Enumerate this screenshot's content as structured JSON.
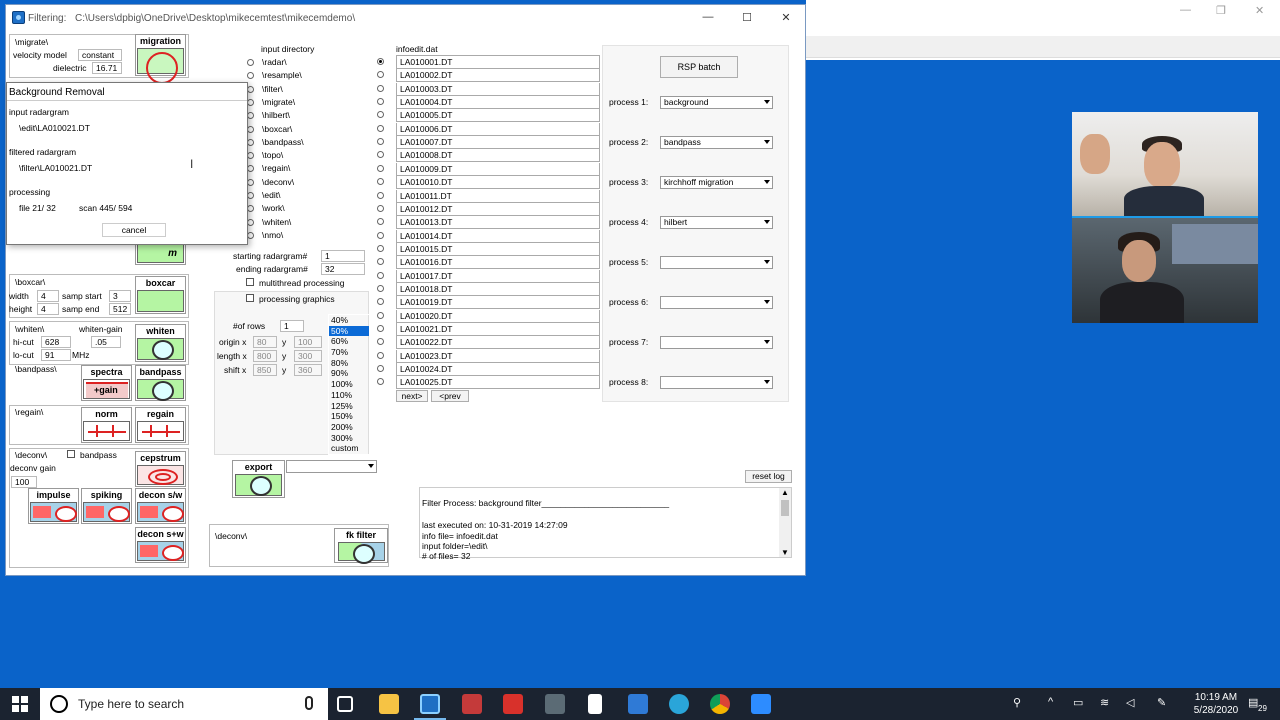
{
  "window": {
    "title": "Filtering:",
    "path": "C:\\Users\\dpbig\\OneDrive\\Desktop\\mikecemtest\\mikecemdemo\\",
    "minimize": "—",
    "maximize": "☐",
    "close": "✕"
  },
  "bg_window": {
    "minimize": "—",
    "restore": "❐",
    "close": "✕"
  },
  "migrate": {
    "dir": "\\migrate\\",
    "velocity_label": "velocity model",
    "velocity_value": "constant",
    "dielectric_label": "dielectric",
    "dielectric_value": "16.71",
    "button": "migration"
  },
  "dialog": {
    "title": "Background Removal",
    "input_label": "input radargram",
    "input_value": "\\edit\\LA010021.DT",
    "filtered_label": "filtered radargram",
    "filtered_value": "\\filter\\LA010021.DT",
    "processing_label": "processing",
    "file_text": "file  21/ 32",
    "scan_text": "scan  445/ 594",
    "cancel": "cancel"
  },
  "mtool": "m",
  "boxcar": {
    "dir": "\\boxcar\\",
    "width_label": "width",
    "width_value": "4",
    "height_label": "height",
    "height_value": "4",
    "samp_start_label": "samp start",
    "samp_start_value": "3",
    "samp_end_label": "samp end",
    "samp_end_value": "512",
    "button": "boxcar"
  },
  "whiten": {
    "dir": "\\whiten\\",
    "gain_label": "whiten-gain",
    "hicut_label": "hi-cut",
    "hicut_value": "628",
    "gain_value": ".05",
    "locut_label": "lo-cut",
    "locut_value": "91",
    "unit": "MHz",
    "button": "whiten"
  },
  "bandpass": {
    "dir": "\\bandpass\\",
    "spectra": "spectra",
    "spectra_gain": "+gain",
    "button": "bandpass"
  },
  "regain": {
    "dir": "\\regain\\",
    "norm": "norm",
    "button": "regain"
  },
  "decon": {
    "dir": "\\deconv\\",
    "bandpass_label": "bandpass",
    "gain_label": "deconv gain",
    "gain_value": "100",
    "cepstrum": "cepstrum",
    "impulse": "impulse",
    "spiking": "spiking",
    "decon_sw": "decon s/w",
    "decon_sw2": "decon s+w"
  },
  "input_dirs": {
    "header": "input directory",
    "items": [
      "\\radar\\",
      "\\resample\\",
      "\\filter\\",
      "\\migrate\\",
      "\\hilbert\\",
      "\\boxcar\\",
      "\\bandpass\\",
      "\\topo\\",
      "\\regain\\",
      "\\deconv\\",
      "\\edit\\",
      "\\work\\",
      "\\whiten\\",
      "\\nmo\\"
    ]
  },
  "radargram": {
    "start_label": "starting radargram#",
    "start_value": "1",
    "end_label": "ending radargram#",
    "end_value": "32",
    "multithread": "multithread processing",
    "graphics": "processing graphics"
  },
  "grid": {
    "rows_label": "#of rows",
    "rows_value": "1",
    "origin_label": "origin x",
    "origin_x": "80",
    "origin_y": "100",
    "length_label": "length x",
    "length_x": "800",
    "length_y": "300",
    "shift_label": "shift x",
    "shift_x": "850",
    "shift_y": "360",
    "y_label": "y"
  },
  "zoom": {
    "options": [
      "40%",
      "50%",
      "60%",
      "70%",
      "80%",
      "90%",
      "100%",
      "110%",
      "125%",
      "150%",
      "200%",
      "300%",
      "custom"
    ],
    "selected": "50%"
  },
  "export": {
    "button": "export"
  },
  "fk": {
    "dir": "\\deconv\\",
    "button": "fk filter"
  },
  "files": {
    "header": "infoedit.dat",
    "items": [
      "LA010001.DT",
      "LA010002.DT",
      "LA010003.DT",
      "LA010004.DT",
      "LA010005.DT",
      "LA010006.DT",
      "LA010007.DT",
      "LA010008.DT",
      "LA010009.DT",
      "LA010010.DT",
      "LA010011.DT",
      "LA010012.DT",
      "LA010013.DT",
      "LA010014.DT",
      "LA010015.DT",
      "LA010016.DT",
      "LA010017.DT",
      "LA010018.DT",
      "LA010019.DT",
      "LA010020.DT",
      "LA010021.DT",
      "LA010022.DT",
      "LA010023.DT",
      "LA010024.DT",
      "LA010025.DT"
    ],
    "next": "next>",
    "prev": "<prev"
  },
  "batch": {
    "button": "RSP batch",
    "processes": [
      {
        "label": "process 1:",
        "value": "background"
      },
      {
        "label": "process 2:",
        "value": "bandpass"
      },
      {
        "label": "process 3:",
        "value": "kirchhoff migration"
      },
      {
        "label": "process 4:",
        "value": "hilbert"
      },
      {
        "label": "process 5:",
        "value": ""
      },
      {
        "label": "process 6:",
        "value": ""
      },
      {
        "label": "process 7:",
        "value": ""
      },
      {
        "label": "process 8:",
        "value": ""
      }
    ]
  },
  "log": {
    "reset": "reset log",
    "line1": "Filter Process:  background filter___________________________",
    "line2": "last executed on:          10-31-2019  14:27:09",
    "line3": "info file=   infoedit.dat",
    "line4": "input folder=\\edit\\",
    "line5": "# of files=     32"
  },
  "taskbar": {
    "search": "Type here to search",
    "time": "10:19 AM",
    "date": "5/28/2020",
    "notifications": "29"
  },
  "colors": {
    "desktop": "#0a63c9",
    "taskbar": "#1b2330",
    "selection": "#0b6ad6"
  }
}
